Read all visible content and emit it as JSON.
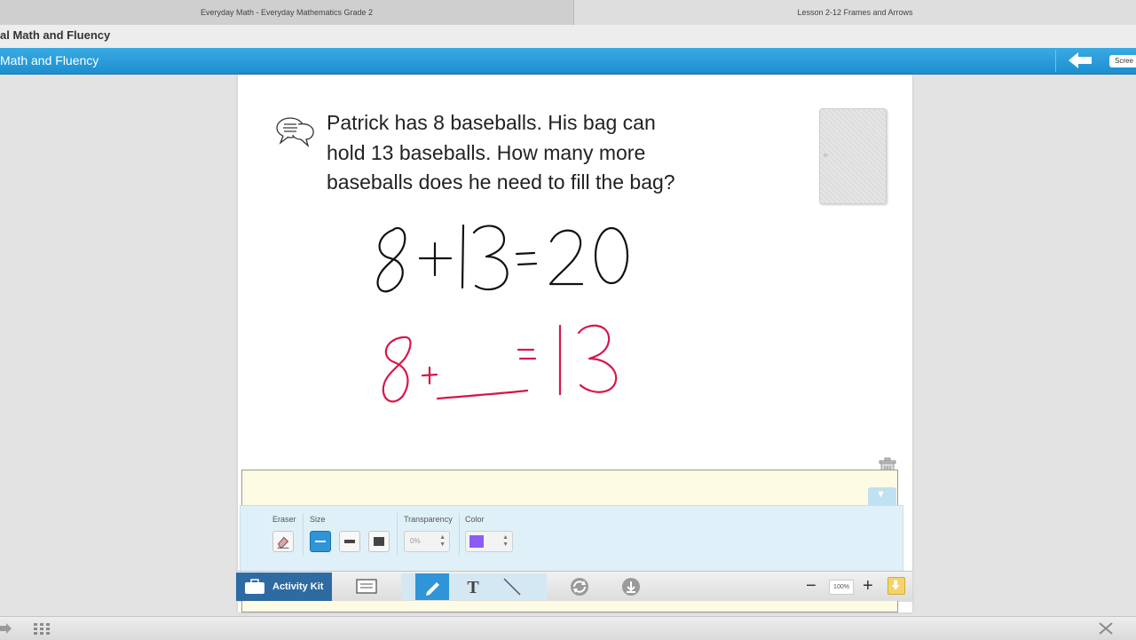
{
  "tabs": [
    {
      "label": "Everyday Math - Everyday Mathematics Grade 2"
    },
    {
      "label": "Lesson 2-12 Frames and Arrows"
    }
  ],
  "header": {
    "title": "al Math and Fluency",
    "bar_title": "Math and Fluency",
    "screen_label": "Scree"
  },
  "problem": {
    "lines": [
      "Patrick has 8 baseballs. His bag can",
      "hold 13 baseballs. How many more",
      "baseballs does he need to fill the bag?"
    ]
  },
  "ink": {
    "black_color": "#111111",
    "red_color": "#d6174a"
  },
  "toolbar": {
    "eraser_label": "Eraser",
    "size_label": "Size",
    "transparency_label": "Transparency",
    "transparency_value": "0%",
    "color_label": "Color",
    "selected_color": "#8b5cf6"
  },
  "bottombar": {
    "activity_kit_label": "Activity Kit",
    "zoom_value": "100%"
  },
  "colors": {
    "accent": "#2f95d6",
    "header_blue": "#1c8fcf",
    "notepad": "#fdfbe3"
  }
}
